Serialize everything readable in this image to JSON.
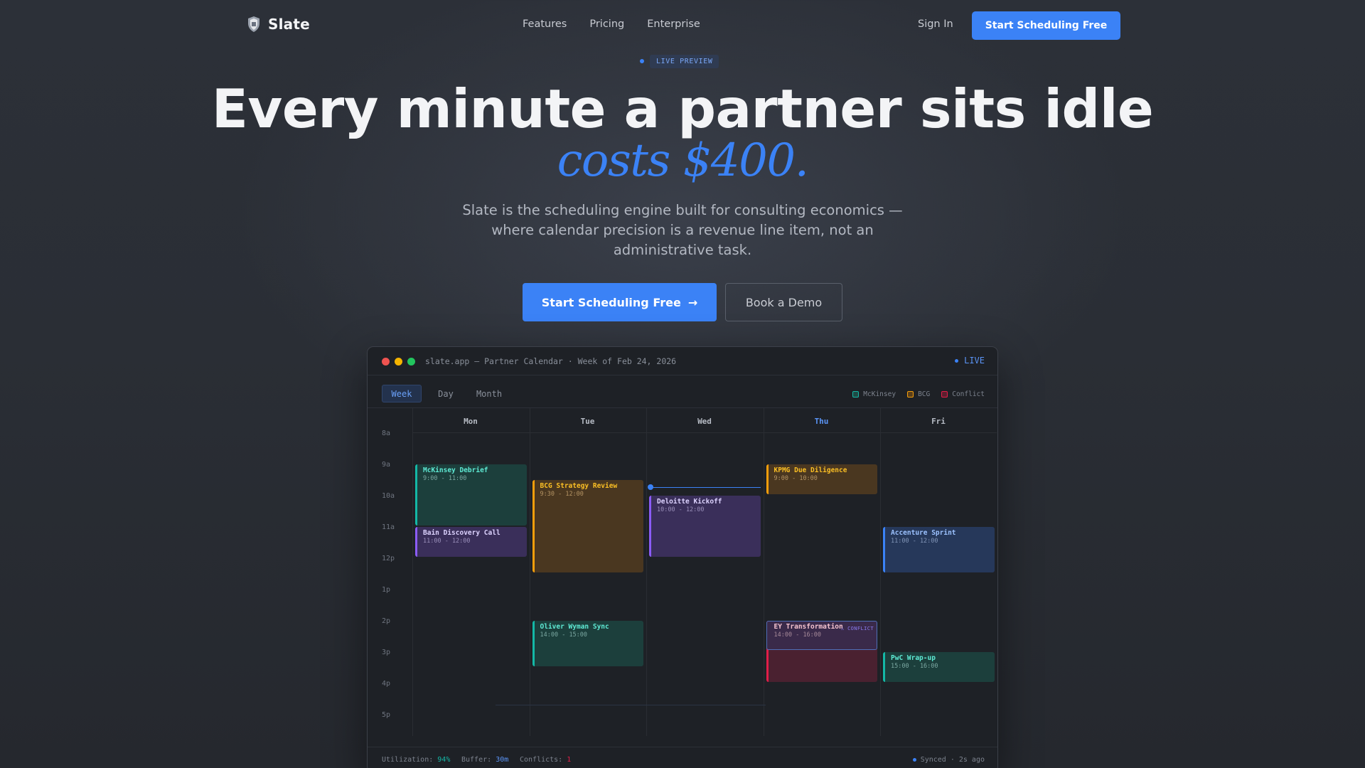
{
  "nav": {
    "brand": "Slate",
    "links": [
      "Features",
      "Pricing",
      "Enterprise"
    ],
    "signin": "Sign In",
    "cta": "Start Scheduling Free"
  },
  "hero": {
    "badge": "LIVE PREVIEW",
    "headline": "Every minute a partner sits idle",
    "accent": "costs $400.",
    "subtitle": "Slate is the scheduling engine built for consulting economics — where calendar precision is a revenue line item, not an administrative task.",
    "cta_primary": "Start Scheduling Free",
    "cta_primary_icon": "→",
    "cta_secondary": "Book a Demo"
  },
  "app": {
    "title": "slate.app — Partner Calendar · Week of Feb 24, 2026",
    "live": "LIVE",
    "views": [
      "Week",
      "Day",
      "Month"
    ],
    "active_view": "Week",
    "legend": [
      {
        "label": "McKinsey",
        "color": "#14b8a6"
      },
      {
        "label": "BCG",
        "color": "#f59e0b"
      },
      {
        "label": "Conflict",
        "color": "#e11d48"
      }
    ],
    "days": [
      "Mon",
      "Tue",
      "Wed",
      "Thu",
      "Fri"
    ],
    "today": "Thu",
    "hours": [
      "8a",
      "9a",
      "10a",
      "11a",
      "12p",
      "1p",
      "2p",
      "3p",
      "4p",
      "5p"
    ],
    "events": [
      {
        "day": 0,
        "start": 9,
        "end": 11,
        "title": "McKinsey Debrief",
        "time": "9:00 - 11:00",
        "kind": "teal"
      },
      {
        "day": 0,
        "start": 11,
        "end": 12,
        "title": "Bain Discovery Call",
        "time": "11:00 - 12:00",
        "kind": "purple"
      },
      {
        "day": 1,
        "start": 9.5,
        "end": 12.5,
        "title": "BCG Strategy Review",
        "time": "9:30 - 12:00",
        "kind": "amber"
      },
      {
        "day": 1,
        "start": 14,
        "end": 15.5,
        "title": "Oliver Wyman Sync",
        "time": "14:00 - 15:00",
        "kind": "teal"
      },
      {
        "day": 2,
        "start": 10,
        "end": 12,
        "title": "Deloitte Kickoff",
        "time": "10:00 - 12:00",
        "kind": "purple"
      },
      {
        "day": 3,
        "start": 9,
        "end": 10,
        "title": "KPMG Due Diligence",
        "time": "9:00 - 10:00",
        "kind": "amber"
      },
      {
        "day": 3,
        "start": 14,
        "end": 16,
        "title": "EY Transformation",
        "time": "14:00 - 16:00",
        "kind": "conflict",
        "tag": "⚠ CONFLICT"
      },
      {
        "day": 4,
        "start": 11,
        "end": 12.5,
        "title": "Accenture Sprint",
        "time": "11:00 - 12:00",
        "kind": "blue"
      },
      {
        "day": 4,
        "start": 15,
        "end": 16,
        "title": "PwC Wrap-up",
        "time": "15:00 - 16:00",
        "kind": "teal"
      }
    ],
    "now_time": 9.75,
    "footer": {
      "util_label": "Utilization:",
      "util_value": "94%",
      "buffer_label": "Buffer:",
      "buffer_value": "30m",
      "conflicts_label": "Conflicts:",
      "conflicts_value": "1",
      "synced": "Synced · 2s ago"
    }
  },
  "colors": {
    "accent": "#3b82f6",
    "teal": "#14b8a6",
    "amber": "#f59e0b",
    "purple": "#8b5cf6",
    "conflict": "#e11d48"
  }
}
